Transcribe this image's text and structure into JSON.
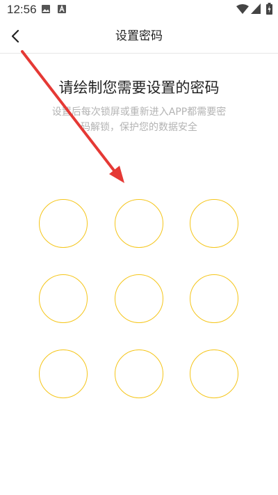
{
  "status_bar": {
    "time": "12:56",
    "icons": [
      "image-icon",
      "a-icon",
      "wifi-icon",
      "signal-icon",
      "battery-charging-icon"
    ]
  },
  "nav": {
    "back_icon": "chevron-left-icon",
    "title": "设置密码"
  },
  "content": {
    "heading": "请绘制您需要设置的密码",
    "subtext": "设置后每次锁屏或重新进入APP都需要密码解锁，保护您的数据安全"
  },
  "pattern": {
    "rows": 3,
    "cols": 3,
    "node_color": "#f5c518"
  },
  "annotation": {
    "arrow_color": "#e53935"
  },
  "colors": {
    "background": "#ffffff",
    "text_primary": "#222222",
    "text_secondary": "#b3b3b3",
    "divider": "#e6e6e6"
  }
}
